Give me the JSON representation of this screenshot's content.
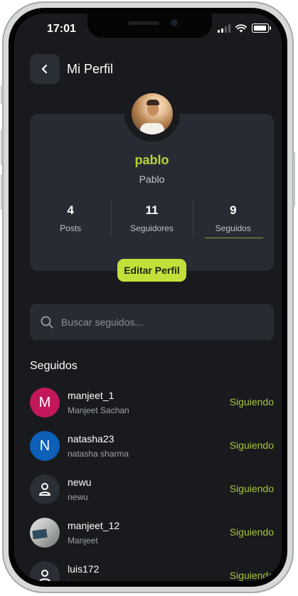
{
  "status_bar": {
    "time": "17:01"
  },
  "header": {
    "title": "Mi Perfil"
  },
  "profile": {
    "name": "pablo",
    "display_name": "Pablo",
    "stats": [
      {
        "value": "4",
        "label": "Posts"
      },
      {
        "value": "11",
        "label": "Seguidores"
      },
      {
        "value": "9",
        "label": "Seguidos",
        "active": true
      }
    ],
    "edit_label": "Editar Perfil"
  },
  "search": {
    "placeholder": "Buscar seguidos..."
  },
  "section": {
    "title": "Seguidos"
  },
  "following": [
    {
      "username": "manjeet_1",
      "full_name": "Manjeet Sachan",
      "avatar_letter": "M",
      "avatar_color": "#c2185b",
      "action": "Siguiendo"
    },
    {
      "username": "natasha23",
      "full_name": "natasha sharma",
      "avatar_letter": "N",
      "avatar_color": "#0d5fb8",
      "action": "Siguiendo"
    },
    {
      "username": "newu",
      "full_name": "newu",
      "avatar_icon": "user-icon",
      "avatar_color": "#2a2e35",
      "action": "Siguiendo"
    },
    {
      "username": "manjeet_12",
      "full_name": "Manjeet",
      "avatar_icon": "photo",
      "action": "Siguiendo"
    },
    {
      "username": "luis172",
      "full_name": "luis",
      "avatar_icon": "user-icon",
      "avatar_color": "#2a2e35",
      "action": "Siguiendo"
    }
  ],
  "colors": {
    "accent": "#c3e03a",
    "background": "#181a1d",
    "card": "#272c34"
  }
}
